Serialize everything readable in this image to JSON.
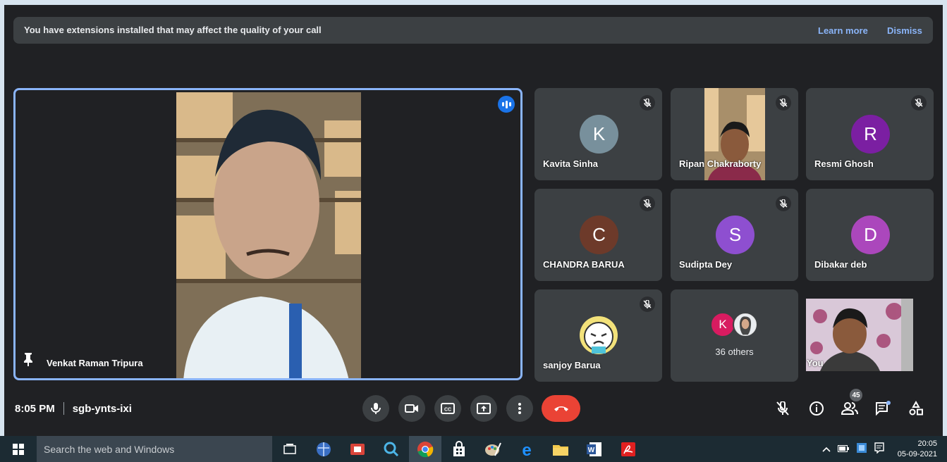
{
  "banner": {
    "message": "You have extensions installed that may affect the quality of your call",
    "learn_more": "Learn more",
    "dismiss": "Dismiss"
  },
  "main_tile": {
    "name": "Venkat Raman Tripura"
  },
  "participants": [
    {
      "name": "Kavita Sinha",
      "initial": "K",
      "color": "#78909c",
      "muted": true
    },
    {
      "name": "Ripan Chakraborty",
      "initial": "",
      "color": "",
      "muted": true,
      "video": true
    },
    {
      "name": "Resmi Ghosh",
      "initial": "R",
      "color": "#7b1fa2",
      "muted": true
    },
    {
      "name": "CHANDRA BARUA",
      "initial": "C",
      "color": "#6d3a2a",
      "muted": true
    },
    {
      "name": "Sudipta Dey",
      "initial": "S",
      "color": "#8e4fd0",
      "muted": true
    },
    {
      "name": "Dibakar deb",
      "initial": "D",
      "color": "#ab47bc",
      "muted": false
    },
    {
      "name": "sanjoy Barua",
      "initial": "",
      "color": "",
      "muted": true,
      "emoji_avatar": true
    },
    {
      "name": "You",
      "initial": "",
      "color": "",
      "muted": false,
      "video": true
    }
  ],
  "others": {
    "label": "36 others",
    "mini_initial": "K",
    "mini_color": "#d81b60"
  },
  "meeting": {
    "time": "8:05 PM",
    "code": "sgb-ynts-ixi"
  },
  "people_count": "45",
  "taskbar": {
    "search_placeholder": "Search the web and Windows",
    "clock_time": "20:05",
    "clock_date": "05-09-2021"
  }
}
